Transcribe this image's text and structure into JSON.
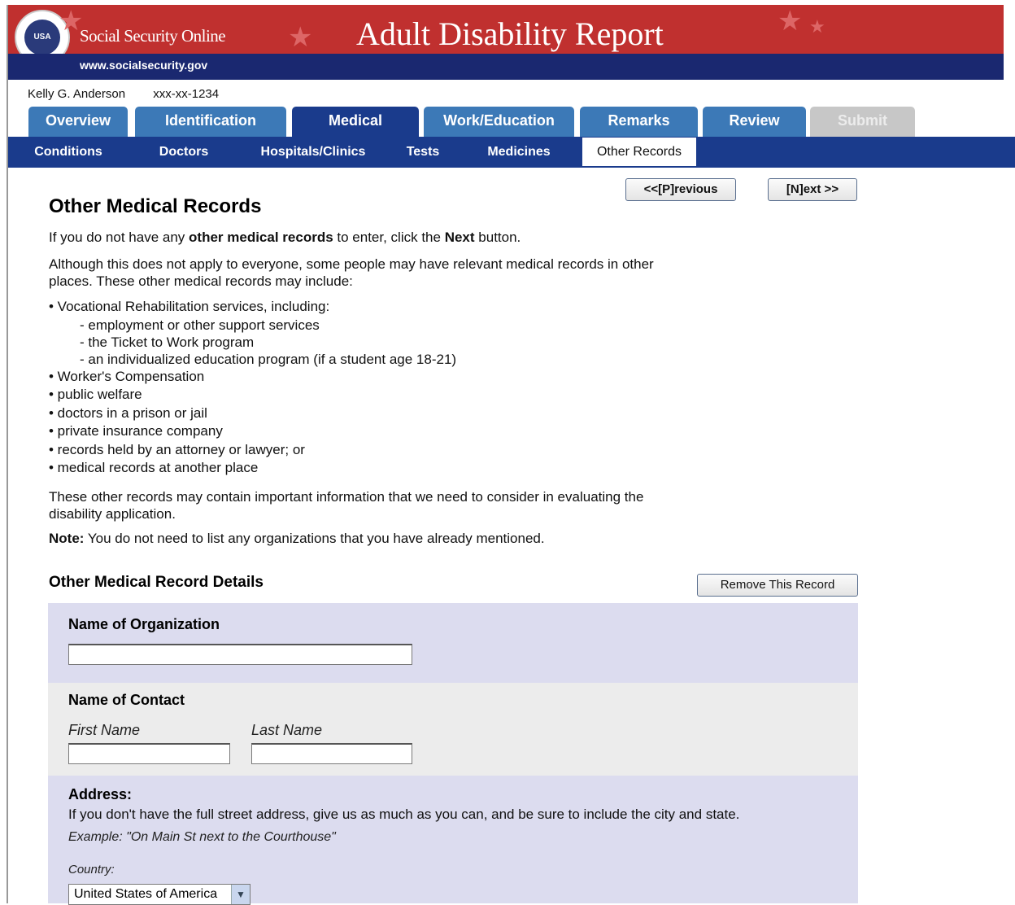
{
  "header": {
    "site_name": "Social Security Online",
    "report_title": "Adult Disability Report",
    "url": "www.socialsecurity.gov",
    "logo_text": "USA"
  },
  "user": {
    "name": "Kelly G. Anderson",
    "ssn": "xxx-xx-1234"
  },
  "tabs": [
    {
      "label": "Overview"
    },
    {
      "label": "Identification"
    },
    {
      "label": "Medical"
    },
    {
      "label": "Work/Education"
    },
    {
      "label": "Remarks"
    },
    {
      "label": "Review"
    },
    {
      "label": "Submit"
    }
  ],
  "subtabs": [
    {
      "label": "Conditions"
    },
    {
      "label": "Doctors"
    },
    {
      "label": "Hospitals/Clinics"
    },
    {
      "label": "Tests"
    },
    {
      "label": "Medicines"
    },
    {
      "label": "Other Records"
    }
  ],
  "nav_buttons": {
    "previous": "<<[P]revious",
    "next": "[N]ext >>"
  },
  "main": {
    "title": "Other Medical Records",
    "intro_1": "If you do not have any",
    "intro_bold": "other medical records",
    "intro_2": "to enter, click the",
    "intro_next": "Next",
    "intro_3": "button.",
    "para_1": "Although this does not apply to everyone, some people may have relevant medical records in other places. These other medical records may include:",
    "list_main": "• Vocational Rehabilitation services, including:",
    "list_sub": [
      "- employment or other support services",
      "- the Ticket to  Work program",
      "- an individualized education program (if a student age 18-21)"
    ],
    "list": [
      "• Worker's Compensation",
      "• public welfare",
      "• doctors in a prison or jail",
      "• private insurance company",
      "• records held by an attorney or lawyer; or",
      "• medical records at another place"
    ],
    "para_2": "These other records may contain important information that we need to consider in evaluating the disability application.",
    "note_label": "Note:",
    "note_text": "You do not need to list any organizations that you have already mentioned."
  },
  "details": {
    "title": "Other Medical Record Details",
    "remove_button": "Remove This Record",
    "org_label": "Name of Organization",
    "org_value": "",
    "contact_label": "Name of Contact",
    "first_name_label": "First Name",
    "last_name_label": "Last Name",
    "first_name_value": "",
    "last_name_value": "",
    "address_label": "Address:",
    "address_help": "If you don't have the full street address, give us as much as you can, and be sure to include the city and state.",
    "address_example": "Example: \"On Main St next to the Courthouse\"",
    "country_label": "Country:",
    "country_value": "United States of America"
  },
  "colors": {
    "banner_red": "#c0302f",
    "navy": "#1a2870",
    "tab_blue": "#3c79b7",
    "tab_active": "#1a3b8c",
    "panel_blue": "#dcdcef",
    "panel_grey": "#ececec"
  }
}
